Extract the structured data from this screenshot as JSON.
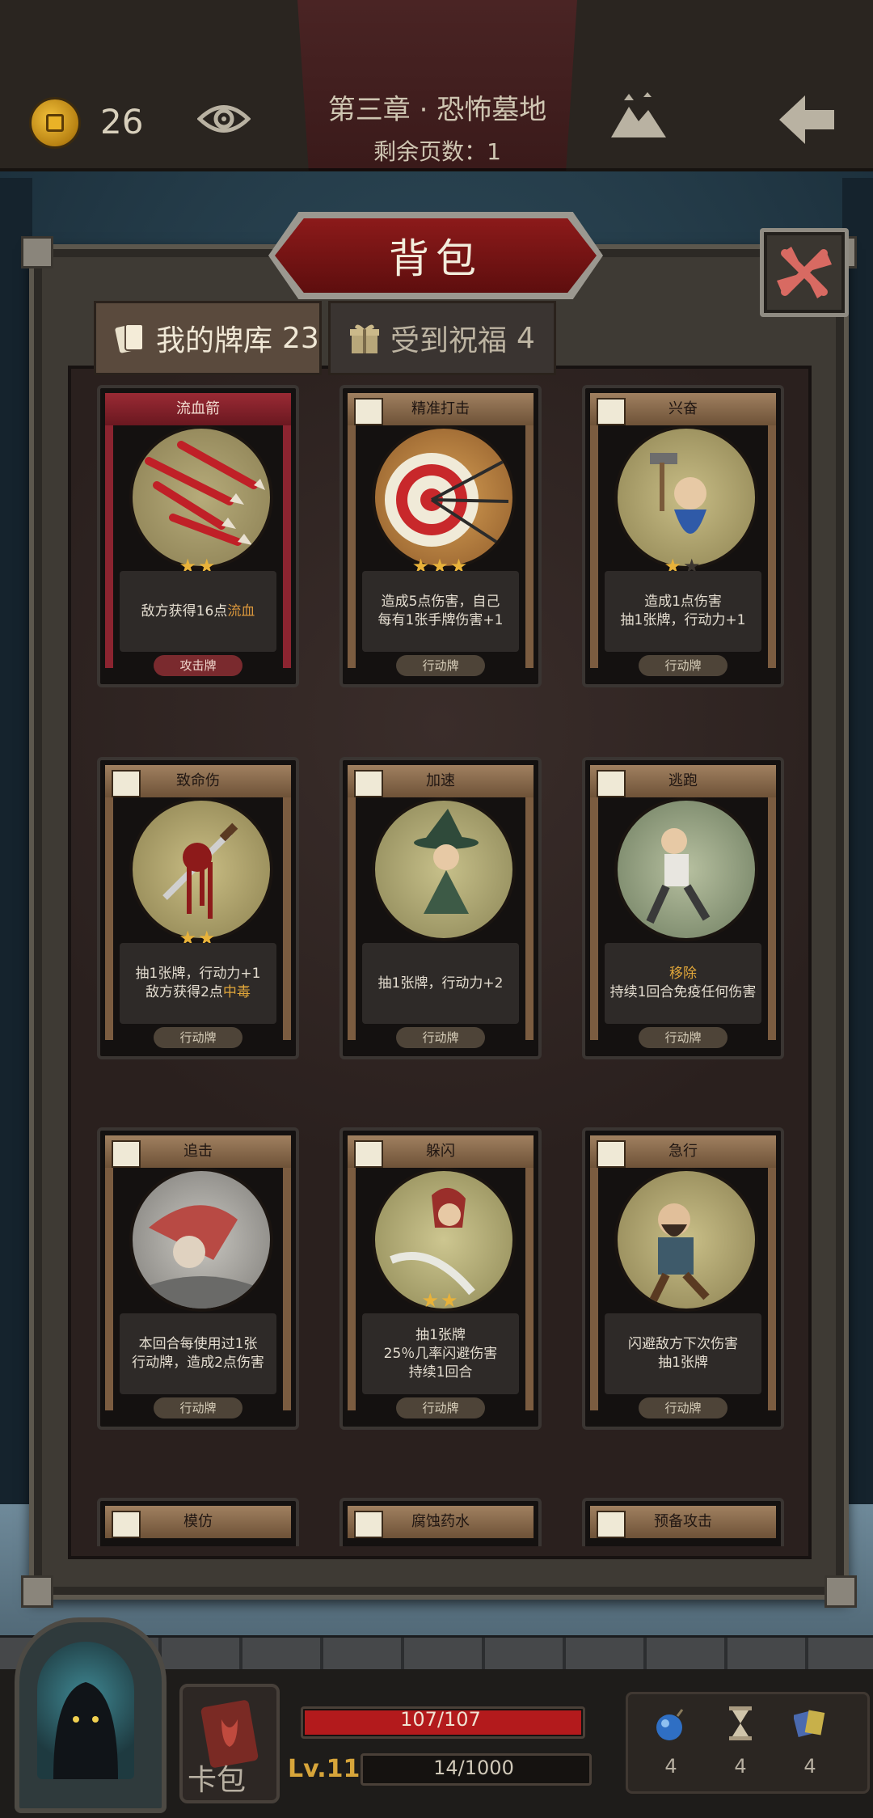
{
  "topbar": {
    "coins": "26",
    "chapter_title": "第三章 · 恐怖墓地",
    "pages_left": "剩余页数：1"
  },
  "panel": {
    "title": "背包",
    "tabs": [
      {
        "label": "我的牌库",
        "count": "23",
        "active": true
      },
      {
        "label": "受到祝福",
        "count": "4",
        "active": false
      }
    ]
  },
  "cards": [
    {
      "name": "流血箭",
      "stars": 2,
      "max_stars": 2,
      "desc_parts": [
        "敌方获得16点",
        "流血"
      ],
      "type": "攻击牌",
      "kind": "attack",
      "art": "bleeding-arrows"
    },
    {
      "name": "精准打击",
      "stars": 3,
      "max_stars": 3,
      "desc_lines": [
        "造成5点伤害，自己",
        "每有1张手牌伤害+1"
      ],
      "type": "行动牌",
      "kind": "action",
      "art": "target-arrows"
    },
    {
      "name": "兴奋",
      "stars": 1,
      "max_stars": 2,
      "desc_lines": [
        "造成1点伤害",
        "抽1张牌，行动力+1"
      ],
      "type": "行动牌",
      "kind": "action",
      "art": "excited-dwarf"
    },
    {
      "name": "致命伤",
      "stars": 2,
      "max_stars": 2,
      "desc_line1": "抽1张牌，行动力+1",
      "desc_parts": [
        "敌方获得2点",
        "中毒"
      ],
      "type": "行动牌",
      "kind": "action",
      "art": "bloody-dagger"
    },
    {
      "name": "加速",
      "stars": 0,
      "max_stars": 0,
      "desc_lines": [
        "抽1张牌，行动力+2"
      ],
      "type": "行动牌",
      "kind": "action",
      "art": "witch"
    },
    {
      "name": "逃跑",
      "stars": 0,
      "max_stars": 0,
      "desc_highlight": "移除",
      "desc_lines": [
        "持续1回合免疫任何伤害"
      ],
      "type": "行动牌",
      "kind": "action",
      "art": "running-man"
    },
    {
      "name": "追击",
      "stars": 0,
      "max_stars": 0,
      "desc_lines": [
        "本回合每使用过1张",
        "行动牌，造成2点伤害"
      ],
      "type": "行动牌",
      "kind": "action",
      "art": "hooded-rider"
    },
    {
      "name": "躲闪",
      "stars": 2,
      "max_stars": 2,
      "desc_lines": [
        "抽1张牌",
        "25％几率闪避伤害",
        "持续1回合"
      ],
      "type": "行动牌",
      "kind": "action",
      "art": "red-hood"
    },
    {
      "name": "急行",
      "stars": 0,
      "max_stars": 0,
      "desc_lines": [
        "闪避敌方下次伤害",
        "抽1张牌"
      ],
      "type": "行动牌",
      "kind": "action",
      "art": "bearded-runner"
    },
    {
      "name": "模仿",
      "kind": "action",
      "art": "partial"
    },
    {
      "name": "腐蚀药水",
      "kind": "action",
      "art": "partial"
    },
    {
      "name": "预备攻击",
      "kind": "action",
      "art": "partial"
    }
  ],
  "hud": {
    "hp": "107/107",
    "hp_fraction": 1.0,
    "level": "Lv.11",
    "xp": "14/1000",
    "xp_fraction": 0.014,
    "card_pack_label": "卡包",
    "resources": [
      {
        "icon": "bomb-icon",
        "count": "4"
      },
      {
        "icon": "hourglass-icon",
        "count": "4"
      },
      {
        "icon": "cards-icon",
        "count": "4"
      }
    ]
  },
  "colors": {
    "attack_red": "#9a2a34",
    "action_brown": "#a08060",
    "star_gold": "#e8b23a",
    "hp_red": "#b31a1c",
    "level_gold": "#d7a53a"
  }
}
